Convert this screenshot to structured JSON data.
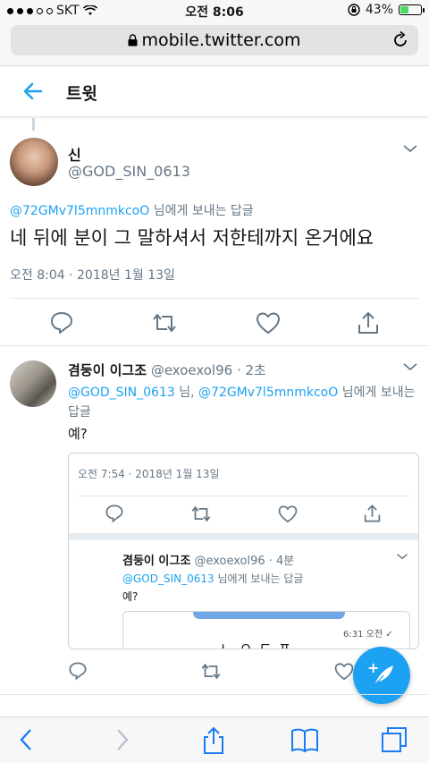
{
  "status": {
    "carrier": "SKT",
    "time": "오전 8:06",
    "battery": "43%",
    "battery_level": 0.43
  },
  "browser": {
    "url": "mobile.twitter.com"
  },
  "header": {
    "title": "트윗"
  },
  "main_tweet": {
    "name": "신",
    "handle": "@GOD_SIN_0613",
    "reply_mention": "@72GMv7l5mnmkcoO",
    "reply_suffix": " 님에게 보내는 답글",
    "text": "네 뒤에 분이 그 말하셔서 저한테까지 온거에요",
    "timestamp": "오전 8:04 · 2018년 1월 13일"
  },
  "reply_tweet": {
    "name": "겸둥이 이그조",
    "handle": "@exoexol96",
    "age": "· 2초",
    "mention1": "@GOD_SIN_0613",
    "mid": " 님, ",
    "mention2": "@72GMv7l5mnmkcoO",
    "suffix": " 님에게 보내는 답글",
    "text": "예?"
  },
  "quoted": {
    "timestamp": "오전 7:54 · 2018년 1월 13일",
    "name": "겸둥이 이그조",
    "handle": "@exoexol96",
    "age": "· 4분",
    "mention": "@GOD_SIN_0613",
    "suffix": " 님에게 보내는 답글",
    "text": "예?",
    "image_stamp": "6:31 오전 ✓",
    "image_word": "ㄴㅇㄷㅍ"
  },
  "colors": {
    "accent": "#1da1f2",
    "text": "#14171a",
    "secondary": "#657786",
    "border": "#e1e8ed"
  }
}
